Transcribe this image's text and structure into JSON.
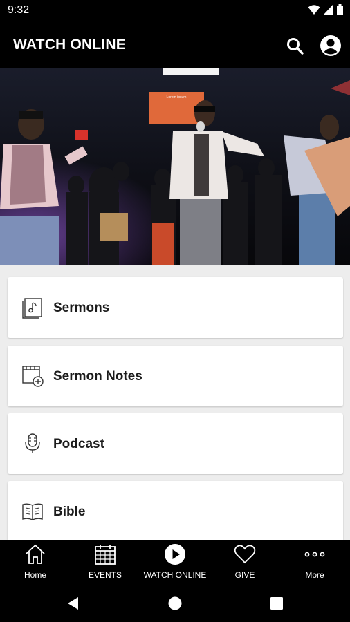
{
  "status_bar": {
    "time": "9:32",
    "icons": [
      "wifi-icon",
      "cell-signal-icon",
      "battery-icon"
    ]
  },
  "app_bar": {
    "title": "WATCH ONLINE",
    "actions": [
      "search-icon",
      "profile-icon"
    ]
  },
  "hero": {
    "image": "worship-stage-photo",
    "screen_text": "Lorem ipsum"
  },
  "menu": [
    {
      "label": "Sermons",
      "icon": "music-note-book-icon"
    },
    {
      "label": "Sermon Notes",
      "icon": "note-add-icon"
    },
    {
      "label": "Podcast",
      "icon": "microphone-icon"
    },
    {
      "label": "Bible",
      "icon": "open-book-icon"
    }
  ],
  "bottom_nav": {
    "items": [
      {
        "label": "Home",
        "icon": "home-icon"
      },
      {
        "label": "EVENTS",
        "icon": "calendar-icon"
      },
      {
        "label": "WATCH ONLINE",
        "icon": "play-circle-icon",
        "active": true
      },
      {
        "label": "GIVE",
        "icon": "heart-icon"
      },
      {
        "label": "More",
        "icon": "more-dots-icon"
      }
    ]
  },
  "system_nav": [
    "back-icon",
    "home-circle-icon",
    "recents-icon"
  ],
  "colors": {
    "bar_background": "#000000",
    "page_background": "#ededed",
    "card_background": "#ffffff",
    "text_dark": "#1c1c1c"
  }
}
